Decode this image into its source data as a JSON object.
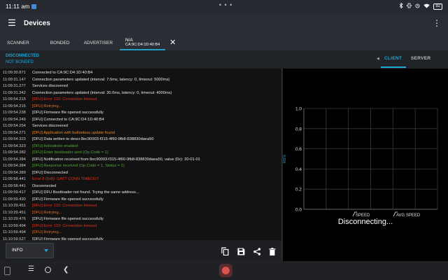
{
  "status_bar": {
    "time": "11:11 am",
    "battery": "92",
    "dots": "• • •"
  },
  "app_bar": {
    "title": "Devices",
    "menu_icon": "hamburger-icon",
    "more_icon": "more-vert-icon"
  },
  "tabs": {
    "scanner": "SCANNER",
    "bonded": "BONDED",
    "advertiser": "ADVERTISER",
    "device_name": "N/A",
    "device_address": "CA:9C:D4:1D:40:B4"
  },
  "connection": {
    "state": "DISCONNECTED",
    "bond": "NOT BONDED",
    "client_tab": "CLIENT",
    "server_tab": "SERVER"
  },
  "log": [
    {
      "ts": "11:09:30.871",
      "msg": "Connected to CA:9C:D4:1D:40:B4",
      "level": "info"
    },
    {
      "ts": "11:09:31.147",
      "msg": "Connection parameters updated (interval: 7.5ms, latency: 0, timeout: 5000ms)",
      "level": "info"
    },
    {
      "ts": "11:09:31.277",
      "msg": "Services discovered",
      "level": "info"
    },
    {
      "ts": "11:09:31.342",
      "msg": "Connection parameters updated (interval: 30.0ms, latency: 0, timeout: 4000ms)",
      "level": "info"
    },
    {
      "ts": "11:09:54.215",
      "msg": "[DFU] Error 133: Connection timeout",
      "level": "error"
    },
    {
      "ts": "11:09:54.215",
      "msg": "[DFU] Retrying...",
      "level": "warn"
    },
    {
      "ts": "11:09:54.238",
      "msg": "[DFU] Firmware file opened successfully",
      "level": "info"
    },
    {
      "ts": "11:09:54.249",
      "msg": "[DFU] Connected to CA:9C:D4:1D:40:B4",
      "level": "info"
    },
    {
      "ts": "11:09:54.254",
      "msg": "Services discovered",
      "level": "info"
    },
    {
      "ts": "11:09:54.271",
      "msg": "[DFU] Application with buttonless update found",
      "level": "app"
    },
    {
      "ts": "11:09:54.323",
      "msg": "[DFU] Data written to descr.8ec90003-f315-4f60-9fb8-838830daea50",
      "level": "info"
    },
    {
      "ts": "11:09:54.323",
      "msg": "[DFU] Indications enabled",
      "level": "ok"
    },
    {
      "ts": "11:09:54.382",
      "msg": "[DFU] Enter bootloader sent (Op Code = 1)",
      "level": "ok"
    },
    {
      "ts": "11:09:54.384",
      "msg": "[DFU] Notification received from 8ec90003-f315-4f60-9fb8-838830daea50, value (0x): 20-01-01",
      "level": "info"
    },
    {
      "ts": "11:09:54.384",
      "msg": "[DFU] Response received (Op Code = 1, Status = 1)",
      "level": "ok"
    },
    {
      "ts": "11:09:54.389",
      "msg": "[DFU] Disconnected",
      "level": "info"
    },
    {
      "ts": "11:09:58.441",
      "msg": "Error 8 (0x8): GATT CONN TIMEOUT",
      "level": "error"
    },
    {
      "ts": "11:09:58.441",
      "msg": "Disconnected",
      "level": "info"
    },
    {
      "ts": "11:09:59.417",
      "msg": "[DFU] DFU Bootloader not found. Trying the same address...",
      "level": "info"
    },
    {
      "ts": "11:09:59.430",
      "msg": "[DFU] Firmware file opened successfully",
      "level": "info"
    },
    {
      "ts": "11:10:29.451",
      "msg": "[DFU] Error 133: Connection timeout",
      "level": "error"
    },
    {
      "ts": "11:10:29.451",
      "msg": "[DFU] Retrying...",
      "level": "warn"
    },
    {
      "ts": "11:10:29.476",
      "msg": "[DFU] Firmware file opened successfully",
      "level": "info"
    },
    {
      "ts": "11:10:59.494",
      "msg": "[DFU] Error 133: Connection timeout",
      "level": "error"
    },
    {
      "ts": "11:10:59.494",
      "msg": "[DFU] Retrying...",
      "level": "warn"
    },
    {
      "ts": "11:10:59.527",
      "msg": "[DFU] Firmware file opened successfully",
      "level": "info"
    }
  ],
  "toolbar": {
    "log_level": "INFO",
    "copy_icon": "copy-icon",
    "save_icon": "save-icon",
    "share_icon": "share-icon",
    "delete_icon": "delete-icon"
  },
  "chart_data": {
    "type": "line",
    "ylabel": "kB/s",
    "yticks": [
      "0.0",
      "0.2",
      "0.4",
      "0.6",
      "0.8",
      "1.0"
    ],
    "ylim": [
      0,
      1
    ],
    "x_gridlines": 6,
    "grid": true,
    "series": [
      {
        "name": "SPEED",
        "values": []
      },
      {
        "name": "AVG SPEED",
        "values": []
      }
    ],
    "legend_position": "bottom"
  },
  "chart_status": "Disconnecting..."
}
